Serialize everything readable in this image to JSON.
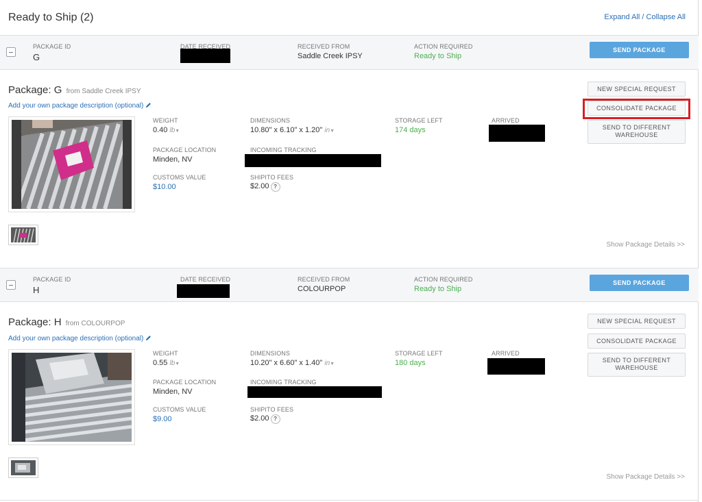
{
  "header": {
    "title": "Ready to Ship (2)",
    "expand_all": "Expand All",
    "separator": " / ",
    "collapse_all": "Collapse All"
  },
  "labels": {
    "package_id": "PACKAGE ID",
    "date_received": "DATE RECEIVED",
    "received_from": "RECEIVED FROM",
    "action_required": "ACTION REQUIRED",
    "send_package": "SEND PACKAGE",
    "package_prefix": "Package: ",
    "from_prefix": "from ",
    "add_description": "Add your own package description (optional)",
    "weight": "WEIGHT",
    "dimensions": "DIMENSIONS",
    "storage_left": "STORAGE LEFT",
    "arrived": "ARRIVED",
    "package_location": "PACKAGE LOCATION",
    "incoming_tracking": "INCOMING TRACKING",
    "customs_value": "CUSTOMS VALUE",
    "shipito_fees": "SHIPITO FEES",
    "new_special_request": "NEW SPECIAL REQUEST",
    "consolidate_package": "CONSOLIDATE PACKAGE",
    "send_to_different_warehouse_1": "SEND TO DIFFERENT",
    "send_to_different_warehouse_2": "WAREHOUSE",
    "show_details": "Show Package Details >>",
    "help": "?",
    "weight_unit": "lb",
    "dim_unit": "in"
  },
  "packages": [
    {
      "id": "G",
      "received_from": "Saddle Creek IPSY",
      "action_required": "Ready to Ship",
      "weight": "0.40",
      "dimensions": "10.80\" x 6.10\" x 1.20\"",
      "storage_left": "174 days",
      "location": "Minden, NV",
      "customs_value": "$10.00",
      "fees": "$2.00"
    },
    {
      "id": "H",
      "received_from": "COLOURPOP",
      "action_required": "Ready to Ship",
      "weight": "0.55",
      "dimensions": "10.20\" x 6.60\" x 1.40\"",
      "storage_left": "180 days",
      "location": "Minden, NV",
      "customs_value": "$9.00",
      "fees": "$2.00"
    }
  ],
  "colors": {
    "accent_blue": "#5aa5de",
    "link_blue": "#2a6fb5",
    "status_green": "#4caf50",
    "highlight_red": "#d81d23"
  }
}
